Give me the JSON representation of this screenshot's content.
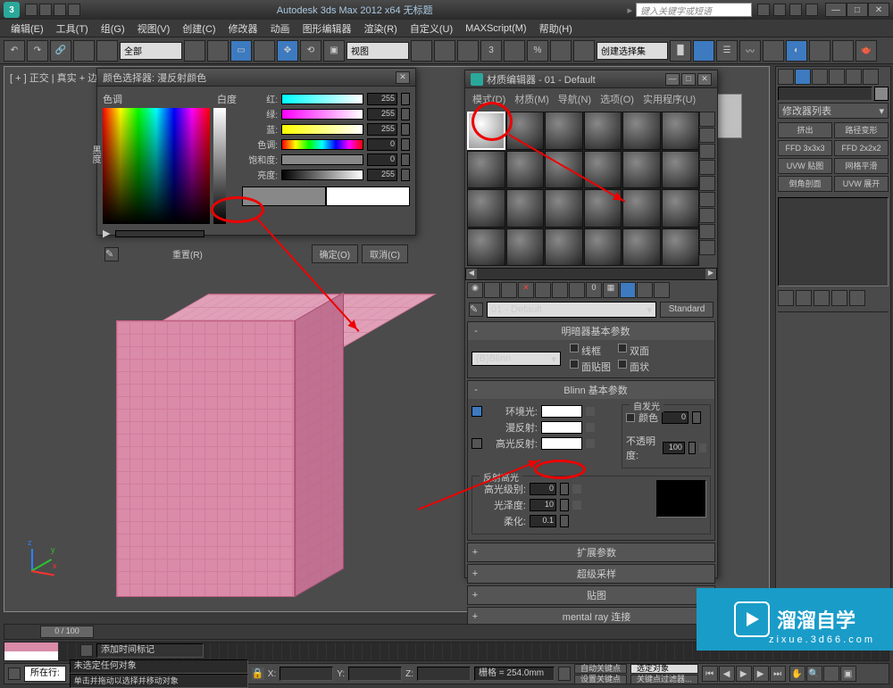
{
  "app": {
    "title": "Autodesk 3ds Max 2012 x64   无标题",
    "search_placeholder": "键入关键字或短语"
  },
  "menubar": [
    "编辑(E)",
    "工具(T)",
    "组(G)",
    "视图(V)",
    "创建(C)",
    "修改器",
    "动画",
    "图形编辑器",
    "渲染(R)",
    "自定义(U)",
    "MAXScript(M)",
    "帮助(H)"
  ],
  "toolbar": {
    "all": "全部",
    "view": "视图",
    "selset": "创建选择集"
  },
  "viewport": {
    "label": "[ + ] 正交 | 真实 + 边面 ]"
  },
  "colorpicker": {
    "title": "颜色选择器: 漫反射颜色",
    "hue_label": "色调",
    "white_label": "白度",
    "black_label": "黑度",
    "channels": {
      "r": "红:",
      "g": "绿:",
      "b": "蓝:",
      "h": "色调:",
      "s": "饱和度:",
      "v": "亮度:"
    },
    "values": {
      "r": 255,
      "g": 255,
      "b": 255,
      "h": 0,
      "s": 0,
      "v": 255
    },
    "reset": "重置(R)",
    "ok": "确定(O)",
    "cancel": "取消(C)"
  },
  "mateditor": {
    "title": "材质编辑器 - 01 - Default",
    "menu": [
      "模式(D)",
      "材质(M)",
      "导航(N)",
      "选项(O)",
      "实用程序(U)"
    ],
    "mat_name": "01 - Default",
    "mat_type": "Standard",
    "rollouts": {
      "shader": {
        "title": "明暗器基本参数",
        "shader": "(B)Blinn",
        "wire": "线框",
        "twoside": "双面",
        "facemap": "面贴图",
        "faceted": "面状"
      },
      "blinn": {
        "title": "Blinn 基本参数",
        "ambient": "环境光:",
        "diffuse": "漫反射:",
        "specular": "高光反射:",
        "selfillum_group": "自发光",
        "color_cb": "颜色",
        "color_val": 0,
        "opacity": "不透明度:",
        "opacity_val": 100,
        "spec_group": "反射高光",
        "spec_level": "高光级别:",
        "spec_level_val": 0,
        "gloss": "光泽度:",
        "gloss_val": 10,
        "soften": "柔化:",
        "soften_val": "0.1"
      },
      "ext": "扩展参数",
      "ss": "超级采样",
      "maps": "贴图",
      "mr": "mental ray 连接"
    }
  },
  "rightpanel": {
    "modlist": "修改器列表",
    "btns": [
      "挤出",
      "路径变形",
      "FFD 3x3x3",
      "FFD 2x2x2",
      "UVW 贴图",
      "网格平滑",
      "倒角剖面",
      "UVW 展开"
    ]
  },
  "timeline": {
    "slider": "0 / 100"
  },
  "status": {
    "none_selected": "未选定任何对象",
    "prompt": "单击并拖动以选择并移动对象",
    "add_time": "添加时间标记",
    "grid": "栅格 = 254.0mm",
    "autokey": "自动关键点",
    "selected": "选定对象",
    "setkey": "设置关键点",
    "keyfilter": "关键点过滤器...",
    "onlayer": "所在行:"
  },
  "watermark": {
    "brand": "溜溜自学",
    "sub": "zixue.3d66.com"
  }
}
